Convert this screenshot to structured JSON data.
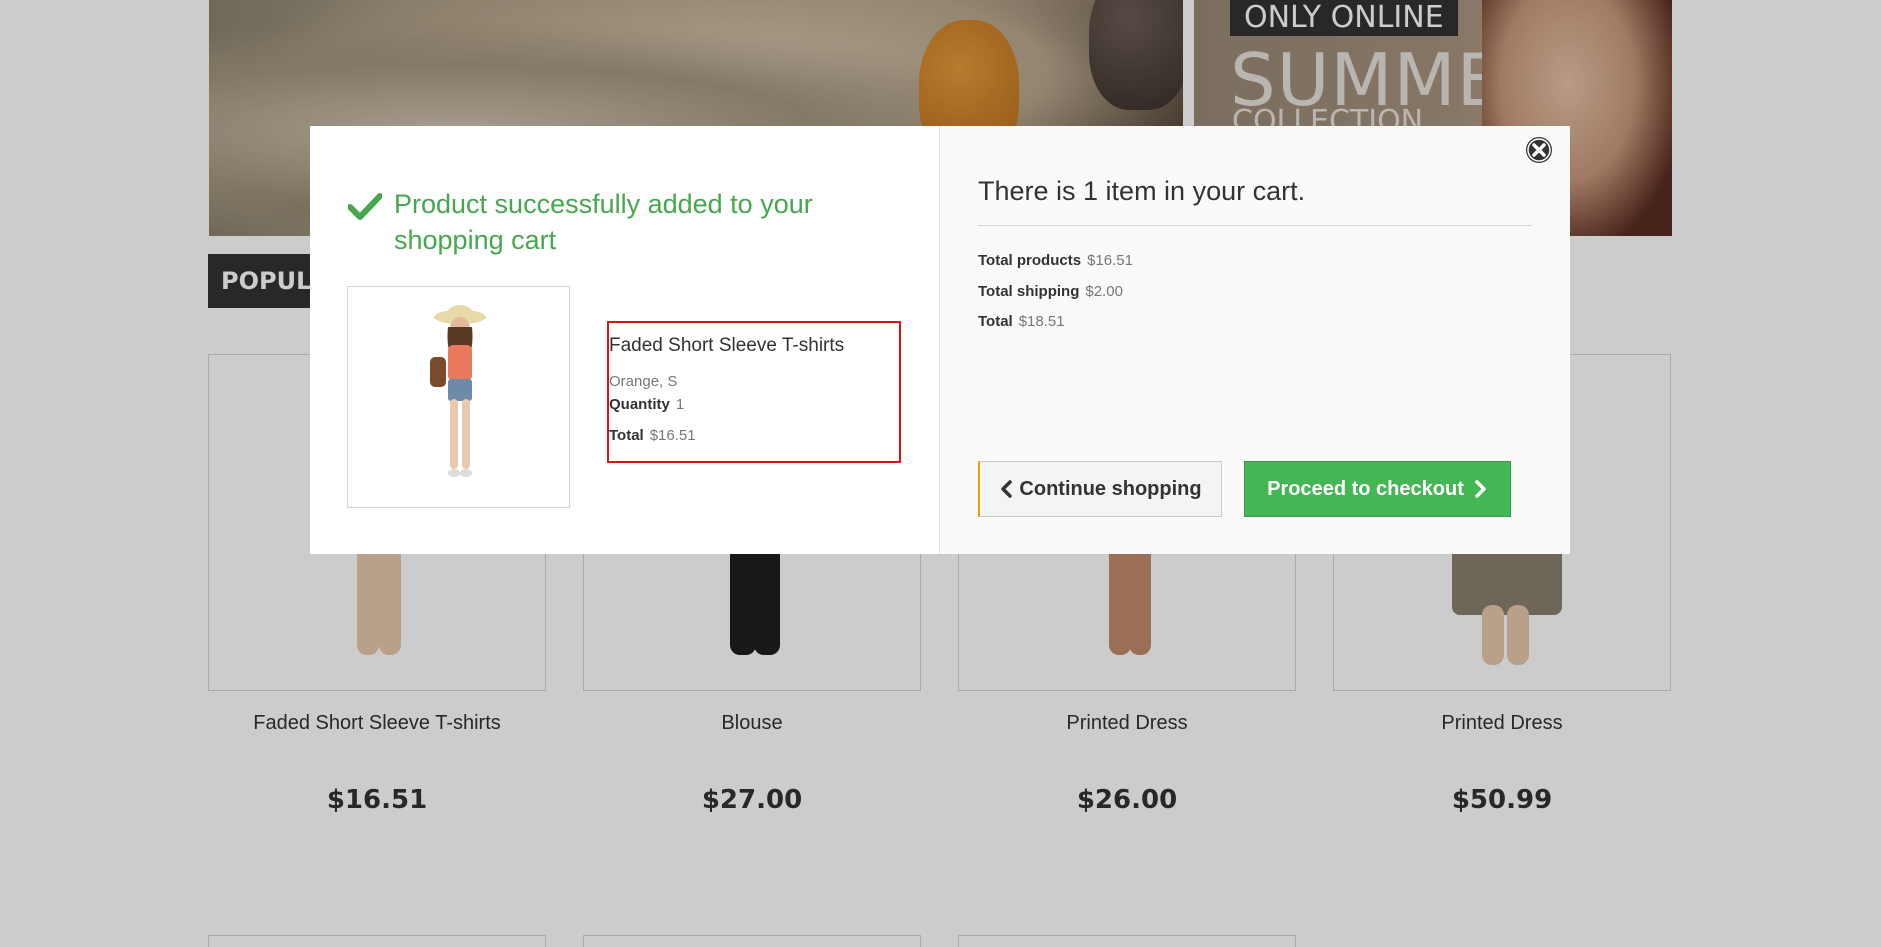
{
  "banner": {
    "only_online": "ONLY ONLINE",
    "summer": "SUMMER",
    "collection": "COLLECTION"
  },
  "section": {
    "popular_tab": "POPULAR"
  },
  "products": [
    {
      "name": "Faded Short Sleeve T-shirts",
      "price": "$16.51"
    },
    {
      "name": "Blouse",
      "price": "$27.00"
    },
    {
      "name": "Printed Dress",
      "price": "$26.00"
    },
    {
      "name": "Printed Dress",
      "price": "$50.99"
    }
  ],
  "modal": {
    "success_message": "Product successfully added to your shopping cart",
    "product": {
      "name": "Faded Short Sleeve T-shirts",
      "attributes": "Orange, S",
      "quantity_label": "Quantity",
      "quantity_value": "1",
      "total_label": "Total",
      "total_value": "$16.51"
    },
    "cart": {
      "title": "There is 1 item in your cart.",
      "total_products_label": "Total products",
      "total_products_value": "$16.51",
      "total_shipping_label": "Total shipping",
      "total_shipping_value": "$2.00",
      "total_label": "Total",
      "total_value": "$18.51"
    },
    "buttons": {
      "continue": "Continue shopping",
      "checkout": "Proceed to checkout"
    }
  },
  "colors": {
    "success_green": "#46a74e",
    "checkout_green": "#43b754",
    "highlight_red": "#d7141a"
  }
}
